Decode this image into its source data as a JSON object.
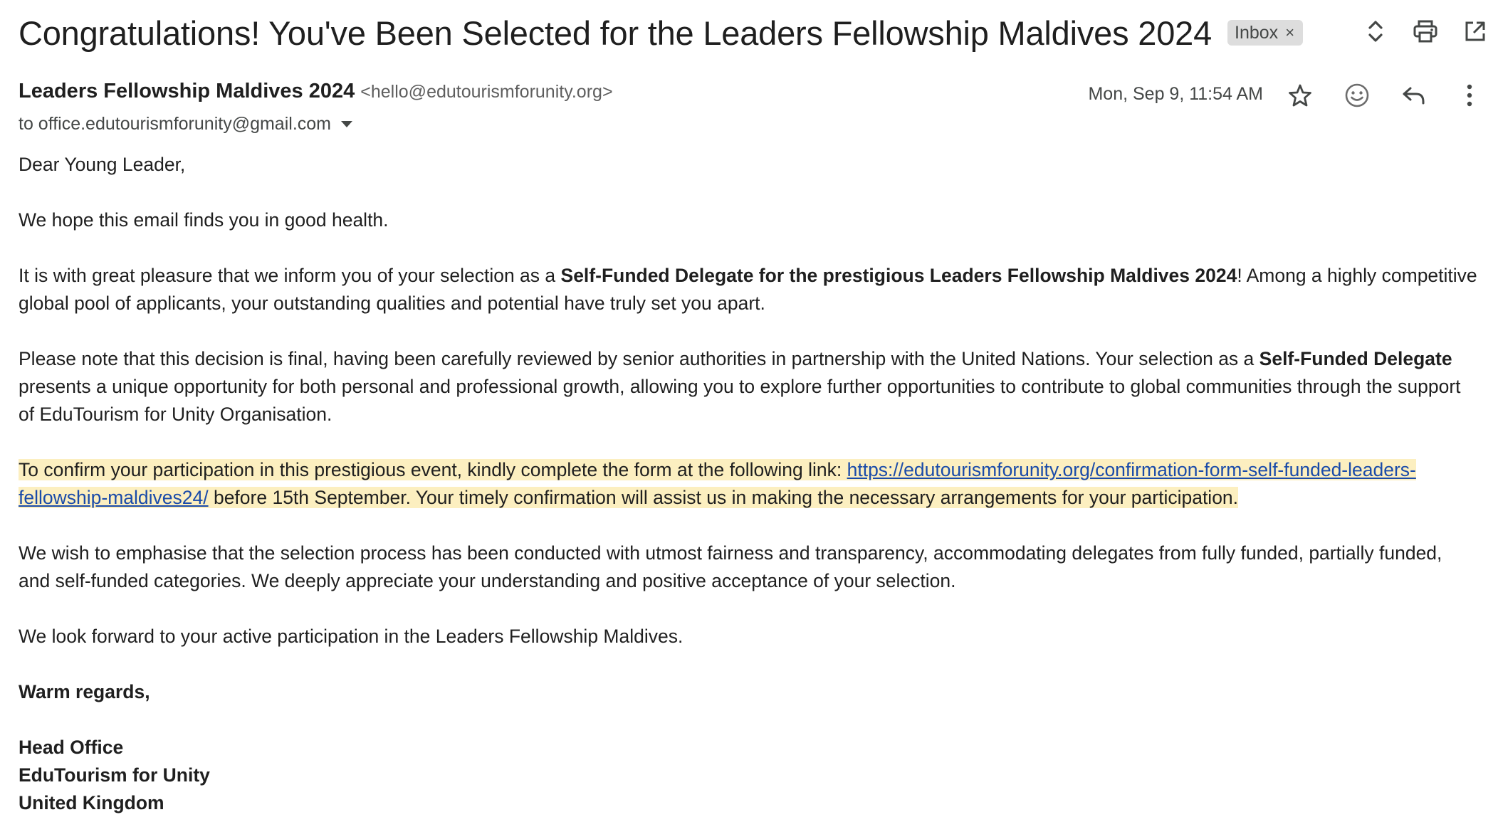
{
  "subject": "Congratulations! You've Been Selected for the Leaders Fellowship Maldives 2024",
  "label_chip": {
    "text": "Inbox",
    "close": "×"
  },
  "header_icons": [
    "expand-collapse-icon",
    "print-icon",
    "open-in-new-window-icon"
  ],
  "sender": {
    "name": "Leaders Fellowship Maldives 2024",
    "email": "<hello@edutourismforunity.org>",
    "to": "to office.edutourismforunity@gmail.com",
    "date": "Mon, Sep 9, 11:54 AM"
  },
  "message_icons": [
    "star-icon",
    "emoji-reaction-icon",
    "reply-icon",
    "more-vertical-icon"
  ],
  "body": {
    "greeting": "Dear Young Leader,",
    "p1": "We hope this email finds you in good health.",
    "p2_a": "It is with great pleasure that we inform you of your selection as a ",
    "p2_b": "Self-Funded Delegate for the prestigious Leaders Fellowship Maldives 2024",
    "p2_c": "! Among a highly competitive global pool of applicants, your outstanding qualities and potential have truly set you apart.",
    "p3_a": "Please note that this decision is final, having been carefully reviewed by senior authorities in partnership with the United Nations. Your selection as a ",
    "p3_b": "Self-Funded Delegate",
    "p3_c": " presents a unique opportunity for both personal and professional growth, allowing you to explore further opportunities to contribute to global communities through the support of EduTourism for Unity Organisation.",
    "p4_a": "To confirm your participation in this prestigious event, kindly complete the form at the following link: ",
    "p4_link": "https://edutourismforunity.org/confirmation-form-self-funded-leaders-fellowship-maldives24/",
    "p4_c": " before 15th September. Your timely confirmation will assist us in making the necessary arrangements for your participation.",
    "p5": "We wish to emphasise that the selection process has been conducted with utmost fairness and transparency, accommodating delegates from fully funded, partially funded, and self-funded categories. We deeply appreciate your understanding and positive acceptance of your selection.",
    "p6": "We look forward to your active participation in the Leaders Fellowship Maldives.",
    "closing": "Warm regards,",
    "sig1": "Head Office",
    "sig2": "EduTourism for Unity",
    "sig3": "United Kingdom"
  },
  "colors": {
    "highlight": "#fcefc0",
    "link": "#1a4ba9",
    "chip_bg": "#dddddd"
  }
}
